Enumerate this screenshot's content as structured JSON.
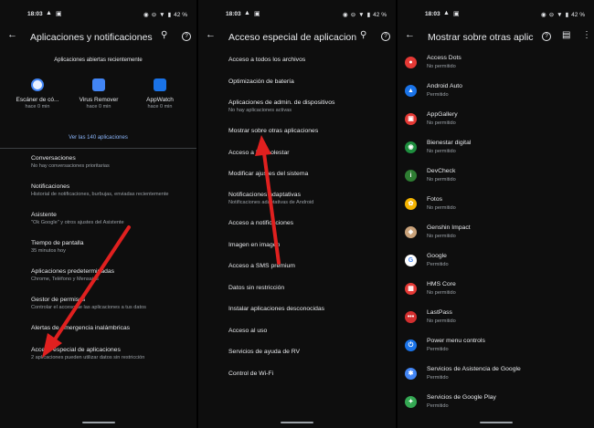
{
  "status": {
    "time": "18:03",
    "battery": "42 %"
  },
  "colors": {
    "accent_link": "#8ab4f8",
    "arrow": "#e0201f"
  },
  "panel1": {
    "title": "Aplicaciones y notificaciones",
    "recent_header": "Aplicaciones abiertas recientemente",
    "recent_apps": [
      {
        "name": "Escáner de có...",
        "time": "hace 0 min"
      },
      {
        "name": "Virus Remover",
        "time": "hace 0 min"
      },
      {
        "name": "AppWatch",
        "time": "hace 0 min"
      }
    ],
    "see_all": "Ver las 140 aplicaciones",
    "items": [
      {
        "title": "Conversaciones",
        "sub": "No hay conversaciones prioritarias"
      },
      {
        "title": "Notificaciones",
        "sub": "Historial de notificaciones, burbujas, enviadas recientemente"
      },
      {
        "title": "Asistente",
        "sub": "\"Ok Google\" y otros ajustes del Asistente"
      },
      {
        "title": "Tiempo de pantalla",
        "sub": "35 minutos hoy"
      },
      {
        "title": "Aplicaciones predeterminadas",
        "sub": "Chrome, Teléfono y Mensajes"
      },
      {
        "title": "Gestor de permisos",
        "sub": "Controlar el acceso de las aplicaciones a tus datos"
      },
      {
        "title": "Alertas de emergencia inalámbricas",
        "sub": ""
      },
      {
        "title": "Acceso especial de aplicaciones",
        "sub": "2 aplicaciones pueden utilizar datos sin restricción"
      }
    ]
  },
  "panel2": {
    "title": "Acceso especial de aplicacion",
    "items": [
      {
        "title": "Acceso a todos los archivos",
        "sub": ""
      },
      {
        "title": "Optimización de batería",
        "sub": ""
      },
      {
        "title": "Aplicaciones de admin. de dispositivos",
        "sub": "No hay aplicaciones activas"
      },
      {
        "title": "Mostrar sobre otras aplicaciones",
        "sub": ""
      },
      {
        "title": "Acceso a No molestar",
        "sub": ""
      },
      {
        "title": "Modificar ajustes del sistema",
        "sub": ""
      },
      {
        "title": "Notificaciones adaptativas",
        "sub": "Notificaciones adaptativas de Android"
      },
      {
        "title": "Acceso a notificaciones",
        "sub": ""
      },
      {
        "title": "Imagen en imagen",
        "sub": ""
      },
      {
        "title": "Acceso a SMS premium",
        "sub": ""
      },
      {
        "title": "Datos sin restricción",
        "sub": ""
      },
      {
        "title": "Instalar aplicaciones desconocidas",
        "sub": ""
      },
      {
        "title": "Acceso al uso",
        "sub": ""
      },
      {
        "title": "Servicios de ayuda de RV",
        "sub": ""
      },
      {
        "title": "Control de Wi-Fi",
        "sub": ""
      }
    ]
  },
  "panel3": {
    "title": "Mostrar sobre otras aplic",
    "apps": [
      {
        "name": "Access Dots",
        "status": "No permitido",
        "color": "#e53935",
        "glyph": "●"
      },
      {
        "name": "Android Auto",
        "status": "Permitido",
        "color": "#1a73e8",
        "glyph": "▲"
      },
      {
        "name": "AppGallery",
        "status": "No permitido",
        "color": "#e53935",
        "glyph": "▣"
      },
      {
        "name": "Bienestar digital",
        "status": "No permitido",
        "color": "#1e8e3e",
        "glyph": "◉"
      },
      {
        "name": "DevCheck",
        "status": "No permitido",
        "color": "#2e7d32",
        "glyph": "i"
      },
      {
        "name": "Fotos",
        "status": "No permitido",
        "color": "#f4b400",
        "glyph": "✿"
      },
      {
        "name": "Genshin Impact",
        "status": "No permitido",
        "color": "#c9a27a",
        "glyph": "◈"
      },
      {
        "name": "Google",
        "status": "Permitido",
        "color": "#ffffff",
        "glyph": "G"
      },
      {
        "name": "HMS Core",
        "status": "No permitido",
        "color": "#e53935",
        "glyph": "▦"
      },
      {
        "name": "LastPass",
        "status": "No permitido",
        "color": "#d32f2f",
        "glyph": "•••"
      },
      {
        "name": "Power menu controls",
        "status": "Permitido",
        "color": "#1a73e8",
        "glyph": "⏻"
      },
      {
        "name": "Servicios de Asistencia de Google",
        "status": "Permitido",
        "color": "#4285f4",
        "glyph": "✱"
      },
      {
        "name": "Servicios de Google Play",
        "status": "Permitido",
        "color": "#34a853",
        "glyph": "✦"
      }
    ]
  }
}
